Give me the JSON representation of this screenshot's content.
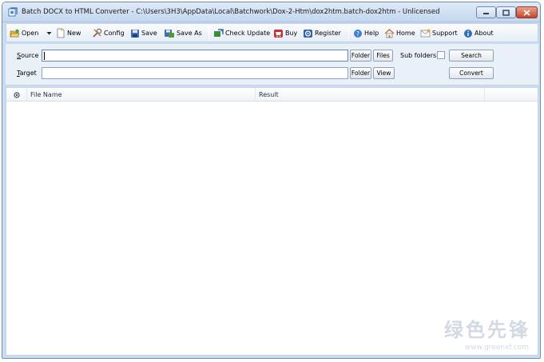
{
  "window": {
    "title": "Batch DOCX to HTML Converter - C:\\Users\\3H3\\AppData\\Local\\Batchwork\\Dox-2-Htm\\dox2htm.batch-dox2htm - Unlicensed"
  },
  "toolbar": {
    "open": "Open",
    "new": "New",
    "config": "Config",
    "save": "Save",
    "save_as": "Save As",
    "check_update": "Check Update",
    "buy": "Buy",
    "register": "Register",
    "help": "Help",
    "home": "Home",
    "support": "Support",
    "about": "About"
  },
  "form": {
    "source_label_key": "S",
    "source_label_rest": "ource",
    "target_label_key": "T",
    "target_label_rest": "arget",
    "source_value": "",
    "target_value": "",
    "source_folder": "Folder",
    "source_files": "Files",
    "sub_folders": "Sub folders",
    "search": "Search",
    "target_folder": "Folder",
    "view": "View",
    "convert": "Convert"
  },
  "list": {
    "columns": [
      "File Name",
      "Result"
    ],
    "rows": []
  },
  "watermark": {
    "main": "绿色先锋",
    "url": "www.greenxf.com"
  },
  "colors": {
    "frame": "#c9dcf1",
    "close_button": "#c5452a",
    "field_border": "#8aa5c6"
  }
}
